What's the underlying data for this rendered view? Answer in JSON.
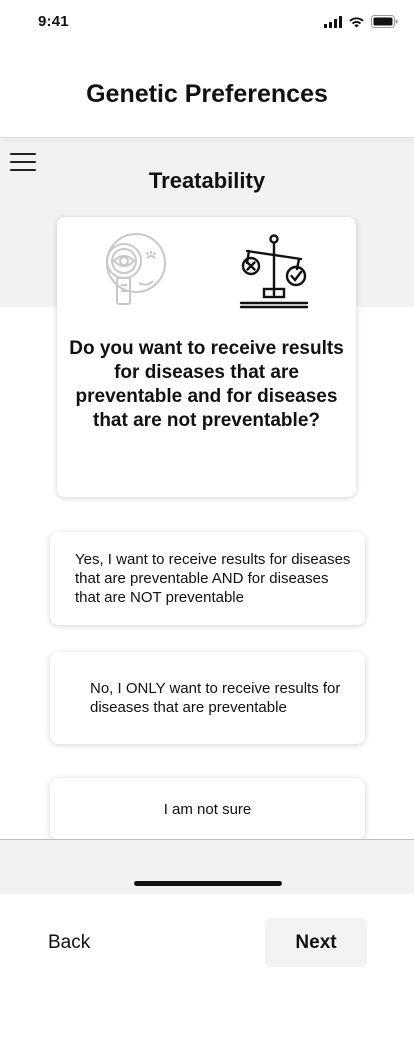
{
  "status_bar": {
    "time": "9:41",
    "icons": [
      "signal-icon",
      "wifi-icon",
      "battery-icon"
    ]
  },
  "header": {
    "title": "Genetic Preferences",
    "menu_icon": "hamburger-menu-icon"
  },
  "section": {
    "title": "Treatability"
  },
  "question": {
    "illustrations": [
      "eye-magnifier-icon",
      "balance-scale-icon"
    ],
    "text": "Do you want to receive results for diseases that are preventable and for diseases that are not preventable?"
  },
  "options": [
    {
      "label": "Yes, I want to receive results for diseases that are preventable AND for diseases that are NOT preventable"
    },
    {
      "label": "No, I ONLY want to receive results for diseases that are preventable"
    },
    {
      "label": "I am not sure"
    }
  ],
  "footer": {
    "back_label": "Back",
    "next_label": "Next"
  },
  "colors": {
    "band_gray": "#f2f2f2",
    "text": "#111111",
    "next_button_bg": "#f3f3f3"
  }
}
